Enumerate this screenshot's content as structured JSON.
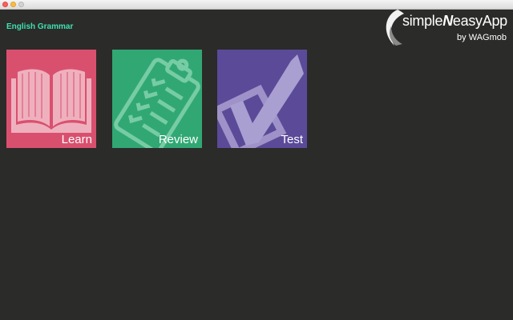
{
  "app": {
    "title": "English Grammar"
  },
  "brand": {
    "name_prefix": "simple",
    "name_emphasis": "N",
    "name_suffix": "easyApp",
    "byline": "by WAGmob"
  },
  "tiles": [
    {
      "label": "Learn",
      "icon": "open-book-icon",
      "color": "#d9506f"
    },
    {
      "label": "Review",
      "icon": "clipboard-checklist-icon",
      "color": "#31a874"
    },
    {
      "label": "Test",
      "icon": "checkbox-check-icon",
      "color": "#5b4a98"
    }
  ],
  "colors": {
    "background": "#2b2b29",
    "title_accent": "#3fe0b0"
  }
}
